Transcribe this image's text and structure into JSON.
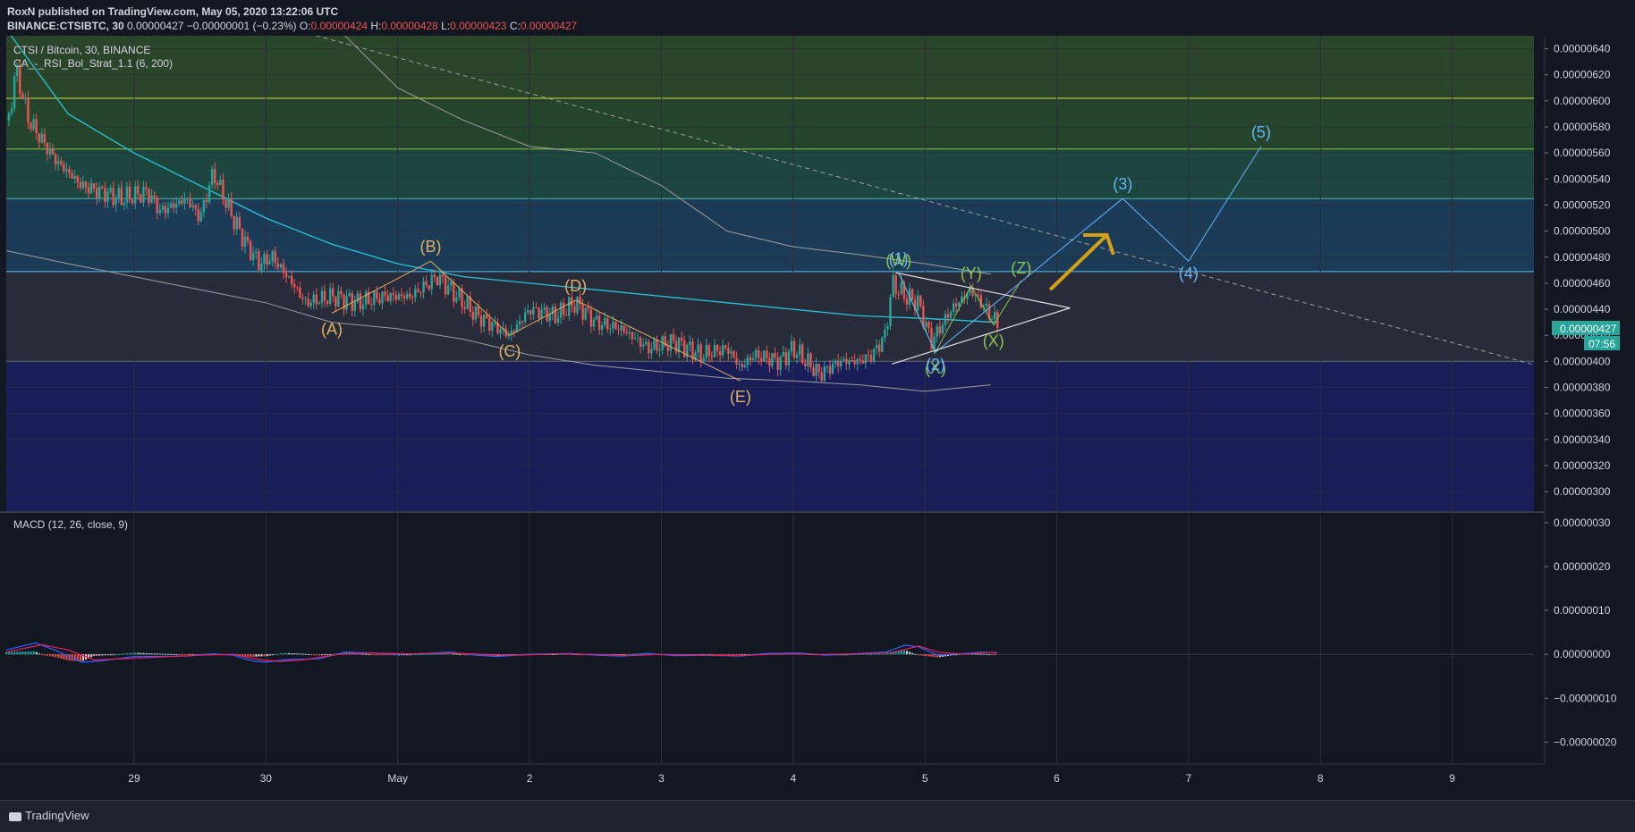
{
  "header": {
    "publisher": "RoxN published on TradingView.com, May 05, 2020 13:22:06 UTC",
    "symbol": "BINANCE:CTSIBTC, 30",
    "last": "0.00000427",
    "change": "−0.00000001 (−0.23%)",
    "o_label": "O:",
    "o": "0.00000424",
    "h_label": "H:",
    "h": "0.00000428",
    "l_label": "L:",
    "l": "0.00000423",
    "c_label": "C:",
    "c": "0.00000427"
  },
  "legend": {
    "title": "CTSI / Bitcoin, 30, BINANCE",
    "indicator": "CA_-_RSI_Bol_Strat_1.1 (6, 200)",
    "macd": "MACD (12, 26, close, 9)"
  },
  "price_tag": "0.00000427",
  "countdown": "07:56",
  "brand": "TradingView",
  "colors": {
    "background": "#131722",
    "bull": "#26a69a",
    "bear": "#ef5350",
    "macd_line": "#2962ff",
    "signal_line": "#e91e63",
    "bb_line": "#9e9e9e",
    "ma_line": "#26c6da",
    "abc_wave": "#e0b060",
    "wxy_wave": "#8bc34a",
    "impulse_wave": "#64b5f6",
    "arrow": "#d4a017"
  },
  "chart_data": [
    {
      "type": "candlestick",
      "title": "CTSI / Bitcoin, 30, BINANCE",
      "y_ticks": [
        "0.00000640",
        "0.00000620",
        "0.00000600",
        "0.00000580",
        "0.00000560",
        "0.00000540",
        "0.00000520",
        "0.00000500",
        "0.00000480",
        "0.00000460",
        "0.00000440",
        "0.00000420",
        "0.00000400",
        "0.00000380",
        "0.00000360",
        "0.00000340",
        "0.00000320",
        "0.00000300"
      ],
      "ylim": [
        2.85e-06,
        6.5e-06
      ],
      "x_ticks": [
        "29",
        "30",
        "May",
        "2",
        "3",
        "4",
        "5",
        "6",
        "7",
        "8",
        "9"
      ],
      "x_tick_days": [
        29,
        30,
        31,
        32,
        33,
        34,
        35,
        36,
        37,
        38,
        39
      ],
      "xlim": [
        28.03,
        39.62
      ],
      "price_path": [
        [
          28.05,
          5.85
        ],
        [
          28.1,
          6.25
        ],
        [
          28.2,
          5.85
        ],
        [
          28.4,
          5.55
        ],
        [
          28.6,
          5.35
        ],
        [
          28.9,
          5.25
        ],
        [
          29.1,
          5.3
        ],
        [
          29.2,
          5.15
        ],
        [
          29.4,
          5.25
        ],
        [
          29.5,
          5.1
        ],
        [
          29.6,
          5.45
        ],
        [
          29.75,
          5.1
        ],
        [
          29.85,
          4.9
        ],
        [
          29.95,
          4.75
        ],
        [
          30.05,
          4.8
        ],
        [
          30.2,
          4.6
        ],
        [
          30.3,
          4.45
        ],
        [
          30.5,
          4.5
        ],
        [
          30.7,
          4.45
        ],
        [
          30.9,
          4.5
        ],
        [
          31.1,
          4.5
        ],
        [
          31.3,
          4.65
        ],
        [
          31.45,
          4.5
        ],
        [
          31.6,
          4.35
        ],
        [
          31.85,
          4.2
        ],
        [
          32.0,
          4.4
        ],
        [
          32.2,
          4.35
        ],
        [
          32.35,
          4.45
        ],
        [
          32.5,
          4.3
        ],
        [
          32.7,
          4.25
        ],
        [
          32.9,
          4.1
        ],
        [
          33.1,
          4.15
        ],
        [
          33.3,
          4.05
        ],
        [
          33.5,
          4.1
        ],
        [
          33.6,
          3.95
        ],
        [
          33.7,
          4.05
        ],
        [
          33.9,
          4.0
        ],
        [
          34.0,
          4.1
        ],
        [
          34.1,
          4.0
        ],
        [
          34.2,
          3.9
        ],
        [
          34.35,
          4.0
        ],
        [
          34.5,
          4.0
        ],
        [
          34.6,
          4.05
        ],
        [
          34.7,
          4.2
        ],
        [
          34.75,
          4.6
        ],
        [
          34.85,
          4.5
        ],
        [
          34.95,
          4.45
        ],
        [
          35.05,
          4.15
        ],
        [
          35.2,
          4.4
        ],
        [
          35.35,
          4.55
        ],
        [
          35.5,
          4.35
        ],
        [
          35.57,
          4.27
        ]
      ],
      "ma200": [
        [
          28.03,
          6.55
        ],
        [
          28.5,
          5.9
        ],
        [
          29,
          5.6
        ],
        [
          29.5,
          5.35
        ],
        [
          30,
          5.1
        ],
        [
          30.5,
          4.9
        ],
        [
          31,
          4.75
        ],
        [
          31.5,
          4.65
        ],
        [
          32,
          4.6
        ],
        [
          32.5,
          4.55
        ],
        [
          33,
          4.5
        ],
        [
          33.5,
          4.45
        ],
        [
          34,
          4.4
        ],
        [
          34.5,
          4.35
        ],
        [
          35,
          4.33
        ],
        [
          35.55,
          4.3
        ]
      ],
      "bb_upper": [
        [
          30.6,
          6.5
        ],
        [
          31,
          6.1
        ],
        [
          31.5,
          5.85
        ],
        [
          32,
          5.65
        ],
        [
          32.5,
          5.6
        ],
        [
          33,
          5.35
        ],
        [
          33.5,
          5.0
        ],
        [
          34,
          4.88
        ],
        [
          34.5,
          4.82
        ],
        [
          35,
          4.75
        ],
        [
          35.5,
          4.67
        ]
      ],
      "bb_lower": [
        [
          28.03,
          4.85
        ],
        [
          28.5,
          4.75
        ],
        [
          29,
          4.65
        ],
        [
          29.5,
          4.55
        ],
        [
          30,
          4.45
        ],
        [
          30.5,
          4.3
        ],
        [
          31,
          4.25
        ],
        [
          31.5,
          4.17
        ],
        [
          32,
          4.05
        ],
        [
          32.5,
          3.97
        ],
        [
          33,
          3.92
        ],
        [
          33.5,
          3.87
        ],
        [
          34,
          3.85
        ],
        [
          34.5,
          3.82
        ],
        [
          35,
          3.77
        ],
        [
          35.5,
          3.82
        ]
      ],
      "abcde_waves": [
        {
          "label": "(A)",
          "day": 30.5,
          "price": 4.37
        },
        {
          "label": "(B)",
          "day": 31.25,
          "price": 4.77
        },
        {
          "label": "(C)",
          "day": 31.85,
          "price": 4.2
        },
        {
          "label": "(D)",
          "day": 32.35,
          "price": 4.47
        },
        {
          "label": "(E)",
          "day": 33.6,
          "price": 3.85
        }
      ],
      "wxyxz_waves": [
        {
          "label": "(W)",
          "day": 34.8,
          "price": 4.68
        },
        {
          "label": "(X)",
          "day": 35.08,
          "price": 4.07
        },
        {
          "label": "(Y)",
          "day": 35.35,
          "price": 4.58
        },
        {
          "label": "(X)",
          "day": 35.52,
          "price": 4.28
        },
        {
          "label": "(Z)",
          "day": 35.73,
          "price": 4.62
        }
      ],
      "impulse_waves": [
        {
          "label": "(1)",
          "day": 34.8,
          "price": 4.68
        },
        {
          "label": "(2)",
          "day": 35.08,
          "price": 4.07
        },
        {
          "label": "(3)",
          "day": 36.5,
          "price": 5.25
        },
        {
          "label": "(4)",
          "day": 37.0,
          "price": 4.77
        },
        {
          "label": "(5)",
          "day": 37.55,
          "price": 5.65
        }
      ],
      "horizontal_levels": [
        6.51,
        6.02,
        5.63,
        5.25,
        4.69,
        4.0
      ],
      "zones": [
        {
          "from": 6.51,
          "to": 6.02,
          "color": "#2e4a2b"
        },
        {
          "from": 6.02,
          "to": 5.63,
          "color": "#274a2e"
        },
        {
          "from": 5.63,
          "to": 5.25,
          "color": "#1f4b45"
        },
        {
          "from": 5.25,
          "to": 4.69,
          "color": "#1e3f5c"
        },
        {
          "from": 4.69,
          "to": 4.0,
          "color": "#2b2e3c"
        },
        {
          "from": 4.0,
          "to": 2.85,
          "color": "#1c1f5e"
        }
      ],
      "price_scale_exp": "e-6 (values ×1e-8 units shown as 0.00000xxx)"
    },
    {
      "type": "bar",
      "title": "MACD (12, 26, close, 9)",
      "y_ticks": [
        "0.00000030",
        "0.00000020",
        "0.00000010",
        "0.00000000",
        "−0.00000010",
        "−0.00000020"
      ],
      "ylim": [
        -2.5e-07,
        3.2e-07
      ],
      "macd_line": [
        [
          28.03,
          0.1
        ],
        [
          28.25,
          0.26
        ],
        [
          28.4,
          0.1
        ],
        [
          28.6,
          -0.18
        ],
        [
          28.75,
          -0.15
        ],
        [
          29.0,
          -0.05
        ],
        [
          29.4,
          -0.04
        ],
        [
          29.6,
          0.01
        ],
        [
          29.75,
          -0.02
        ],
        [
          29.9,
          -0.15
        ],
        [
          30.0,
          -0.18
        ],
        [
          30.15,
          -0.12
        ],
        [
          30.4,
          -0.1
        ],
        [
          30.6,
          0.05
        ],
        [
          30.8,
          0.03
        ],
        [
          31.0,
          0.0
        ],
        [
          31.2,
          0.02
        ],
        [
          31.4,
          0.05
        ],
        [
          31.6,
          -0.02
        ],
        [
          31.75,
          -0.05
        ],
        [
          32.0,
          0.0
        ],
        [
          32.3,
          0.02
        ],
        [
          32.5,
          -0.02
        ],
        [
          32.7,
          -0.04
        ],
        [
          32.9,
          0.02
        ],
        [
          33.1,
          -0.03
        ],
        [
          33.35,
          -0.02
        ],
        [
          33.6,
          -0.04
        ],
        [
          33.8,
          0.02
        ],
        [
          34.05,
          0.03
        ],
        [
          34.25,
          -0.02
        ],
        [
          34.5,
          0.02
        ],
        [
          34.7,
          0.05
        ],
        [
          34.85,
          0.21
        ],
        [
          34.95,
          0.17
        ],
        [
          35.1,
          -0.02
        ],
        [
          35.3,
          0.02
        ],
        [
          35.45,
          0.05
        ],
        [
          35.55,
          0.03
        ]
      ],
      "signal_line": [
        [
          28.03,
          0.05
        ],
        [
          28.3,
          0.22
        ],
        [
          28.5,
          0.1
        ],
        [
          28.7,
          -0.13
        ],
        [
          28.9,
          -0.1
        ],
        [
          29.2,
          -0.06
        ],
        [
          29.5,
          -0.02
        ],
        [
          29.75,
          0.0
        ],
        [
          29.95,
          -0.12
        ],
        [
          30.1,
          -0.16
        ],
        [
          30.3,
          -0.12
        ],
        [
          30.55,
          0.0
        ],
        [
          30.8,
          0.03
        ],
        [
          31.1,
          0.01
        ],
        [
          31.4,
          0.03
        ],
        [
          31.65,
          0.0
        ],
        [
          31.9,
          -0.02
        ],
        [
          32.2,
          0.01
        ],
        [
          32.5,
          0.0
        ],
        [
          32.75,
          -0.03
        ],
        [
          33.0,
          0.0
        ],
        [
          33.3,
          -0.02
        ],
        [
          33.6,
          -0.03
        ],
        [
          33.9,
          0.01
        ],
        [
          34.2,
          0.0
        ],
        [
          34.5,
          0.01
        ],
        [
          34.75,
          0.04
        ],
        [
          34.95,
          0.19
        ],
        [
          35.1,
          0.05
        ],
        [
          35.3,
          0.0
        ],
        [
          35.45,
          0.04
        ],
        [
          35.55,
          0.04
        ]
      ]
    }
  ]
}
